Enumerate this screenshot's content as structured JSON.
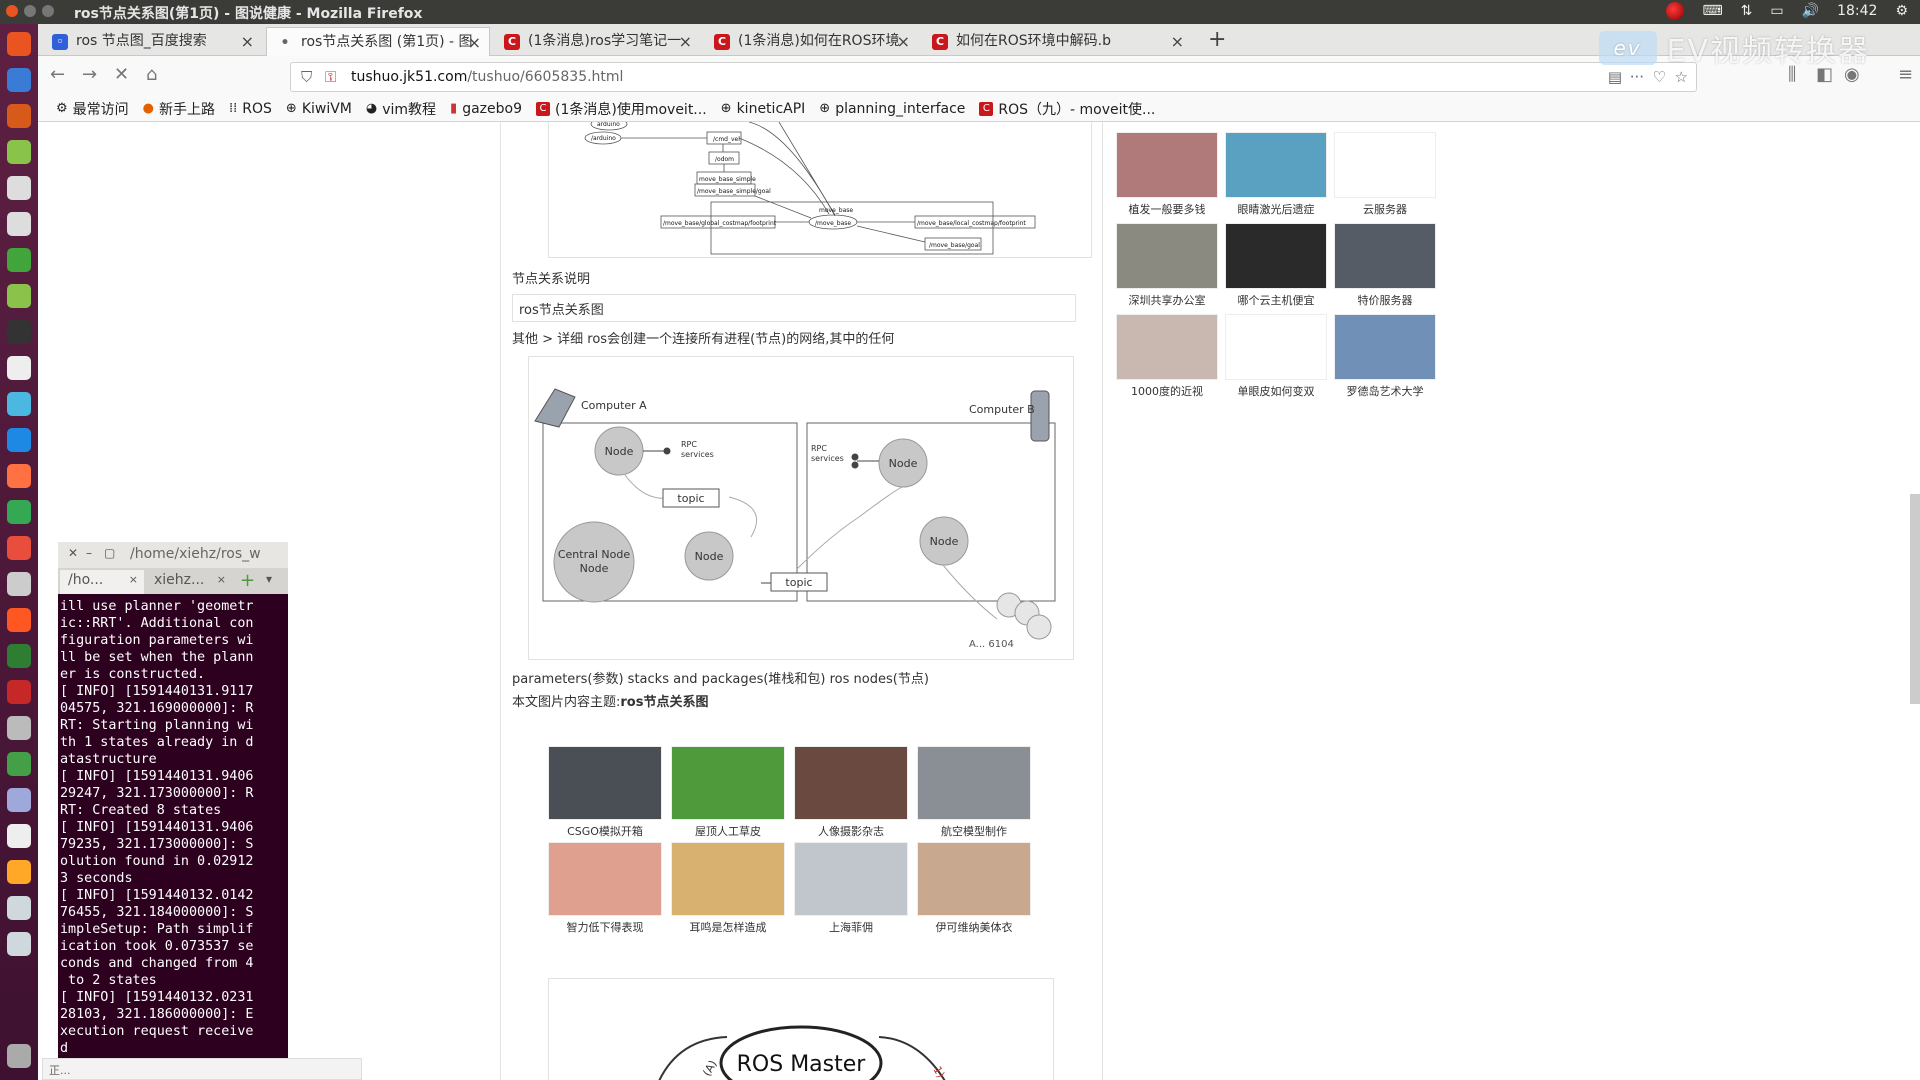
{
  "system": {
    "title": "ros节点关系图(第1页) - 图说健康 - Mozilla Firefox",
    "clock": "18:42",
    "watermark_logo": "ev",
    "watermark": "EV视频转换器"
  },
  "tabs": [
    {
      "label": "ros 节点图_百度搜索",
      "icon": "baidu-icon",
      "color": "#3060d8"
    },
    {
      "label": "ros节点关系图 (第1页) - 图",
      "icon": "loading-icon",
      "color": "#888888"
    },
    {
      "label": "(1条消息)ros学习笔记一",
      "icon": "csdn-icon",
      "color": "#c9171c"
    },
    {
      "label": "(1条消息)如何在ROS环境",
      "icon": "csdn-icon",
      "color": "#c9171c"
    },
    {
      "label": "如何在ROS环境中解码.b",
      "icon": "csdn-icon",
      "color": "#c9171c"
    }
  ],
  "navbar": {
    "url_host": "tushuo.jk51.com",
    "url_path": "/tushuo/6605835.html"
  },
  "bookmarks": [
    {
      "label": "最常访问",
      "icon": "gear-icon"
    },
    {
      "label": "新手上路",
      "icon": "firefox-icon"
    },
    {
      "label": "ROS",
      "icon": "grid-icon"
    },
    {
      "label": "KiwiVM",
      "icon": "globe-icon"
    },
    {
      "label": "vim教程",
      "icon": "github-icon"
    },
    {
      "label": "gazebo9",
      "icon": "bookmark-icon"
    },
    {
      "label": "(1条消息)使用moveit...",
      "icon": "csdn-icon"
    },
    {
      "label": "kineticAPI",
      "icon": "globe-icon"
    },
    {
      "label": "planning_interface",
      "icon": "globe-icon"
    },
    {
      "label": "ROS（九）- moveit使...",
      "icon": "csdn-icon"
    }
  ],
  "content": {
    "caption1": "节点关系说明",
    "box_title": "ros节点关系图",
    "other_line": "其他 > 详细 ros会创建一个连接所有进程(节点)的网络,其中的任何",
    "params_line": "parameters(参数) stacks and packages(堆栈和包) ros nodes(节点)",
    "topic_prefix": "本文图片内容主题:",
    "topic_bold": "ros节点关系图"
  },
  "diagram_top": {
    "labels": [
      "arduino",
      "/arduino",
      "/cmd_vel",
      "/odom",
      "move_base_simple",
      "/move_base_simple/goal",
      "move_base",
      "/move_base/global_costmap/footprint",
      "/move_base",
      "/move_base/local_costmap/footprint",
      "/move_base/goal"
    ]
  },
  "diagram_nodes": {
    "computer_a": "Computer A",
    "computer_b": "Computer B",
    "node": "Node",
    "rpc": "RPC",
    "services": "services",
    "topic": "topic",
    "central1": "Central Node",
    "central2": "Node",
    "watermark": "A... 6104"
  },
  "diagram_master": {
    "label": "ROS Master"
  },
  "thumbs_center": [
    {
      "cap": "CSGO模拟开箱",
      "color": "#4a4f55"
    },
    {
      "cap": "屋顶人工草皮",
      "color": "#4f9a3a"
    },
    {
      "cap": "人像摄影杂志",
      "color": "#6a4a40"
    },
    {
      "cap": "航空模型制作",
      "color": "#8a8f95"
    },
    {
      "cap": "智力低下得表现",
      "color": "#e0a090"
    },
    {
      "cap": "耳鸣是怎样造成",
      "color": "#d8b070"
    },
    {
      "cap": "上海菲佣",
      "color": "#c0c6cc"
    },
    {
      "cap": "伊可维纳美体衣",
      "color": "#c9a890"
    }
  ],
  "thumbs_right": [
    {
      "cap": "植发一般要多钱",
      "color": "#b07a7a"
    },
    {
      "cap": "眼睛激光后遗症",
      "color": "#5aa0c0"
    },
    {
      "cap": "云服务器",
      "color": "#ffffff"
    },
    {
      "cap": "深圳共享办公室",
      "color": "#8a8a80"
    },
    {
      "cap": "哪个云主机便宜",
      "color": "#2a2a2a"
    },
    {
      "cap": "特价服务器",
      "color": "#555c66"
    },
    {
      "cap": "1000度的近视",
      "color": "#c8b8b0"
    },
    {
      "cap": "单眼皮如何变双",
      "color": "#ffffff"
    },
    {
      "cap": "罗德岛艺术大学",
      "color": "#7090b8"
    }
  ],
  "terminal": {
    "title": "/home/xiehz/ros_w",
    "tab1": "/ho...",
    "tab2": "xiehz...",
    "lines": "ill use planner 'geometr\nic::RRT'. Additional con\nfiguration parameters wi\nll be set when the plann\ner is constructed.\n[ INFO] [1591440131.9117\n04575, 321.169000000]: R\nRT: Starting planning wi\nth 1 states already in d\natastructure\n[ INFO] [1591440131.9406\n29247, 321.173000000]: R\nRT: Created 8 states\n[ INFO] [1591440131.9406\n79235, 321.173000000]: S\nolution found in 0.02912\n3 seconds\n[ INFO] [1591440132.0142\n76455, 321.184000000]: S\nimpleSetup: Path simplif\nication took 0.073537 se\nconds and changed from 4\n to 2 states\n[ INFO] [1591440132.0231\n28103, 321.186000000]: E\nxecution request receive\nd"
  },
  "statusbar": "正..."
}
